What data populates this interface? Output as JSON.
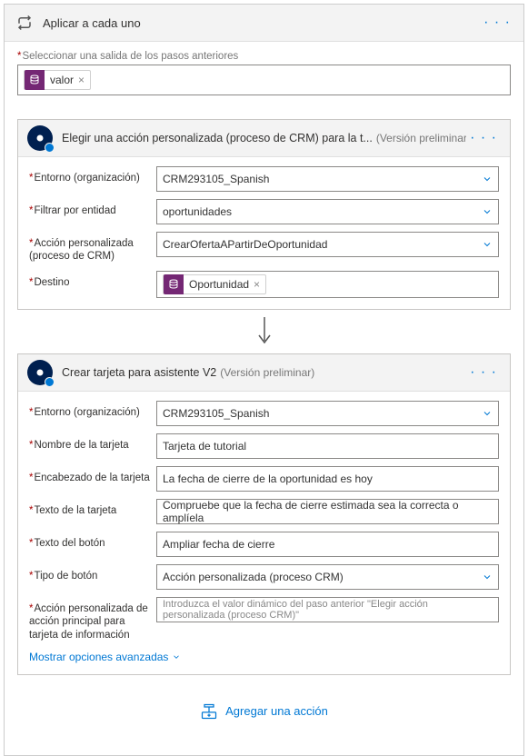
{
  "outer": {
    "title": "Aplicar a cada uno",
    "select_label": "Seleccionar una salida de los pasos anteriores",
    "token_value": "valor"
  },
  "action1": {
    "title": "Elegir una acción personalizada (proceso de CRM) para la t...",
    "preview": "(Versión preliminar)",
    "env_label": "Entorno (organización)",
    "env_value": "CRM293105_Spanish",
    "filter_label": "Filtrar por entidad",
    "filter_value": "oportunidades",
    "custom_label": "Acción personalizada (proceso de CRM)",
    "custom_value": "CrearOfertaAPartirDeOportunidad",
    "dest_label": "Destino",
    "dest_token": "Oportunidad"
  },
  "action2": {
    "title": "Crear tarjeta para asistente V2",
    "preview": "(Versión preliminar)",
    "env_label": "Entorno (organización)",
    "env_value": "CRM293105_Spanish",
    "cardname_label": "Nombre de la tarjeta",
    "cardname_value": "Tarjeta de tutorial",
    "cardheader_label": "Encabezado de la tarjeta",
    "cardheader_value": "La fecha de cierre de la oportunidad es hoy",
    "cardtext_label": "Texto de la tarjeta",
    "cardtext_value": "Compruebe que la fecha de cierre estimada sea la correcta o amplíela",
    "btntext_label": "Texto del botón",
    "btntext_value": "Ampliar fecha de cierre",
    "btntype_label": "Tipo de botón",
    "btntype_value": "Acción personalizada (proceso CRM)",
    "mainact_label": "Acción personalizada de acción principal para tarjeta de información",
    "mainact_placeholder": "Introduzca el valor dinámico del paso anterior \"Elegir acción personalizada (proceso CRM)\"",
    "advanced_link": "Mostrar opciones avanzadas"
  },
  "footer": {
    "add_action": "Agregar una acción"
  }
}
